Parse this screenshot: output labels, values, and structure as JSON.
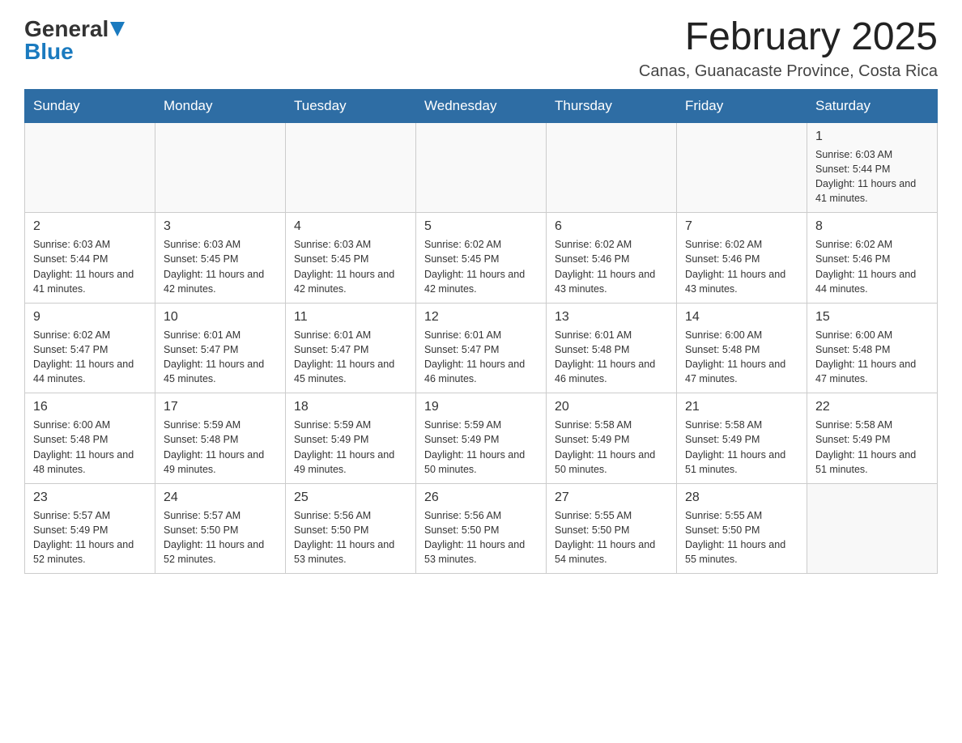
{
  "header": {
    "logo": {
      "general": "General",
      "blue": "Blue"
    },
    "title": "February 2025",
    "subtitle": "Canas, Guanacaste Province, Costa Rica"
  },
  "days_of_week": [
    "Sunday",
    "Monday",
    "Tuesday",
    "Wednesday",
    "Thursday",
    "Friday",
    "Saturday"
  ],
  "weeks": [
    [
      {
        "day": "",
        "info": ""
      },
      {
        "day": "",
        "info": ""
      },
      {
        "day": "",
        "info": ""
      },
      {
        "day": "",
        "info": ""
      },
      {
        "day": "",
        "info": ""
      },
      {
        "day": "",
        "info": ""
      },
      {
        "day": "1",
        "info": "Sunrise: 6:03 AM\nSunset: 5:44 PM\nDaylight: 11 hours and 41 minutes."
      }
    ],
    [
      {
        "day": "2",
        "info": "Sunrise: 6:03 AM\nSunset: 5:44 PM\nDaylight: 11 hours and 41 minutes."
      },
      {
        "day": "3",
        "info": "Sunrise: 6:03 AM\nSunset: 5:45 PM\nDaylight: 11 hours and 42 minutes."
      },
      {
        "day": "4",
        "info": "Sunrise: 6:03 AM\nSunset: 5:45 PM\nDaylight: 11 hours and 42 minutes."
      },
      {
        "day": "5",
        "info": "Sunrise: 6:02 AM\nSunset: 5:45 PM\nDaylight: 11 hours and 42 minutes."
      },
      {
        "day": "6",
        "info": "Sunrise: 6:02 AM\nSunset: 5:46 PM\nDaylight: 11 hours and 43 minutes."
      },
      {
        "day": "7",
        "info": "Sunrise: 6:02 AM\nSunset: 5:46 PM\nDaylight: 11 hours and 43 minutes."
      },
      {
        "day": "8",
        "info": "Sunrise: 6:02 AM\nSunset: 5:46 PM\nDaylight: 11 hours and 44 minutes."
      }
    ],
    [
      {
        "day": "9",
        "info": "Sunrise: 6:02 AM\nSunset: 5:47 PM\nDaylight: 11 hours and 44 minutes."
      },
      {
        "day": "10",
        "info": "Sunrise: 6:01 AM\nSunset: 5:47 PM\nDaylight: 11 hours and 45 minutes."
      },
      {
        "day": "11",
        "info": "Sunrise: 6:01 AM\nSunset: 5:47 PM\nDaylight: 11 hours and 45 minutes."
      },
      {
        "day": "12",
        "info": "Sunrise: 6:01 AM\nSunset: 5:47 PM\nDaylight: 11 hours and 46 minutes."
      },
      {
        "day": "13",
        "info": "Sunrise: 6:01 AM\nSunset: 5:48 PM\nDaylight: 11 hours and 46 minutes."
      },
      {
        "day": "14",
        "info": "Sunrise: 6:00 AM\nSunset: 5:48 PM\nDaylight: 11 hours and 47 minutes."
      },
      {
        "day": "15",
        "info": "Sunrise: 6:00 AM\nSunset: 5:48 PM\nDaylight: 11 hours and 47 minutes."
      }
    ],
    [
      {
        "day": "16",
        "info": "Sunrise: 6:00 AM\nSunset: 5:48 PM\nDaylight: 11 hours and 48 minutes."
      },
      {
        "day": "17",
        "info": "Sunrise: 5:59 AM\nSunset: 5:48 PM\nDaylight: 11 hours and 49 minutes."
      },
      {
        "day": "18",
        "info": "Sunrise: 5:59 AM\nSunset: 5:49 PM\nDaylight: 11 hours and 49 minutes."
      },
      {
        "day": "19",
        "info": "Sunrise: 5:59 AM\nSunset: 5:49 PM\nDaylight: 11 hours and 50 minutes."
      },
      {
        "day": "20",
        "info": "Sunrise: 5:58 AM\nSunset: 5:49 PM\nDaylight: 11 hours and 50 minutes."
      },
      {
        "day": "21",
        "info": "Sunrise: 5:58 AM\nSunset: 5:49 PM\nDaylight: 11 hours and 51 minutes."
      },
      {
        "day": "22",
        "info": "Sunrise: 5:58 AM\nSunset: 5:49 PM\nDaylight: 11 hours and 51 minutes."
      }
    ],
    [
      {
        "day": "23",
        "info": "Sunrise: 5:57 AM\nSunset: 5:49 PM\nDaylight: 11 hours and 52 minutes."
      },
      {
        "day": "24",
        "info": "Sunrise: 5:57 AM\nSunset: 5:50 PM\nDaylight: 11 hours and 52 minutes."
      },
      {
        "day": "25",
        "info": "Sunrise: 5:56 AM\nSunset: 5:50 PM\nDaylight: 11 hours and 53 minutes."
      },
      {
        "day": "26",
        "info": "Sunrise: 5:56 AM\nSunset: 5:50 PM\nDaylight: 11 hours and 53 minutes."
      },
      {
        "day": "27",
        "info": "Sunrise: 5:55 AM\nSunset: 5:50 PM\nDaylight: 11 hours and 54 minutes."
      },
      {
        "day": "28",
        "info": "Sunrise: 5:55 AM\nSunset: 5:50 PM\nDaylight: 11 hours and 55 minutes."
      },
      {
        "day": "",
        "info": ""
      }
    ]
  ]
}
